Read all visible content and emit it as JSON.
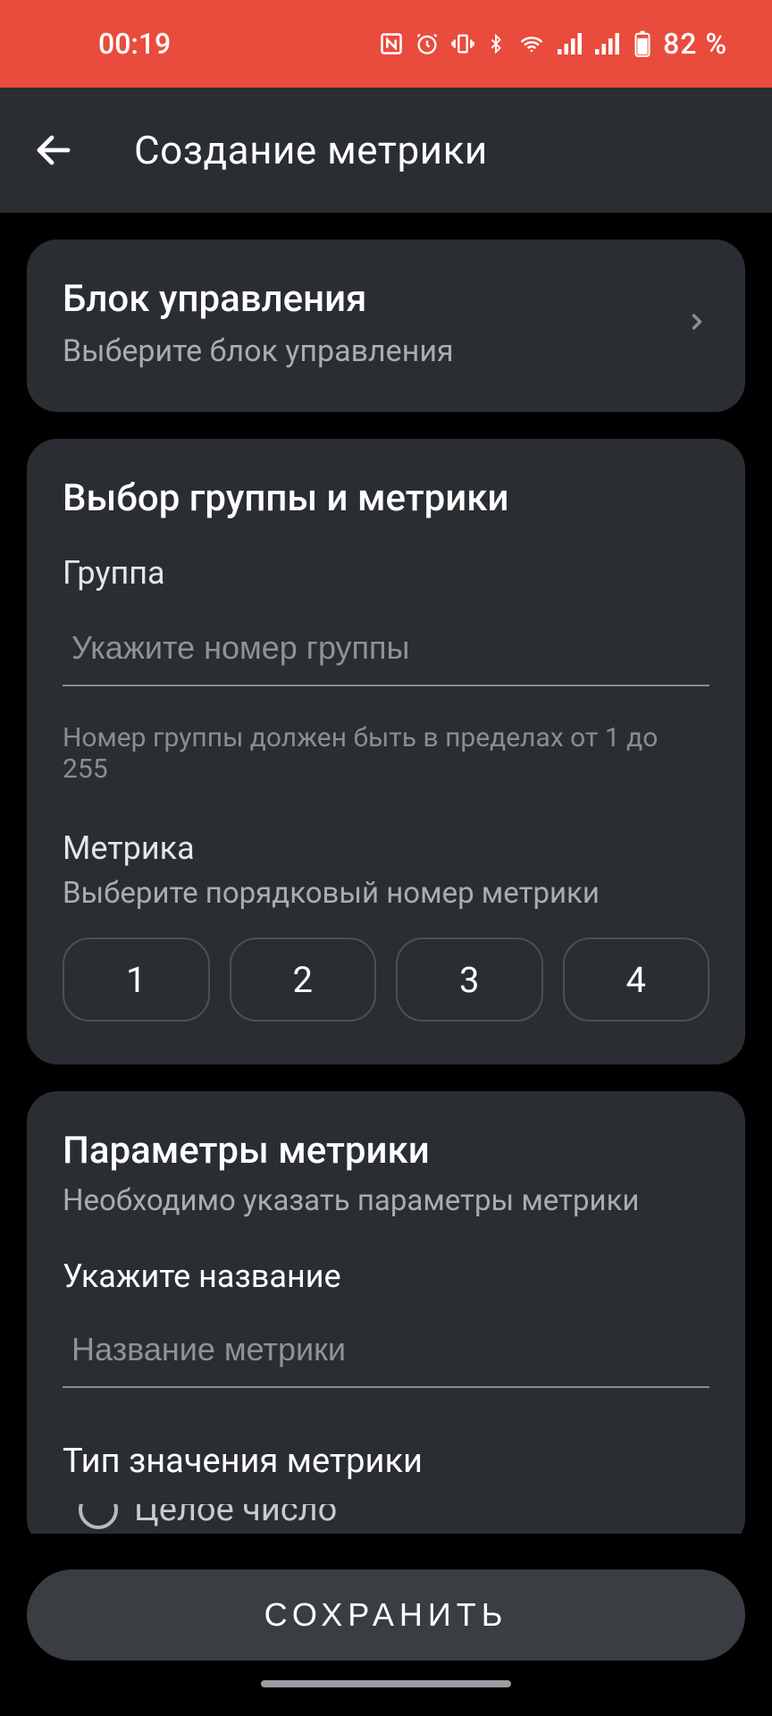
{
  "status": {
    "time": "00:19",
    "battery": "82 %"
  },
  "header": {
    "title": "Создание метрики"
  },
  "control_block": {
    "title": "Блок управления",
    "subtitle": "Выберите блок управления"
  },
  "group_section": {
    "title": "Выбор группы и метрики",
    "group_label": "Группа",
    "group_placeholder": "Укажите номер группы",
    "group_helper": "Номер группы должен быть в пределах от 1 до 255",
    "metric_label": "Метрика",
    "metric_sub": "Выберите порядковый номер метрики",
    "options": [
      "1",
      "2",
      "3",
      "4"
    ]
  },
  "params_section": {
    "title": "Параметры метрики",
    "subtitle": "Необходимо указать параметры метрики",
    "name_label": "Укажите название",
    "name_placeholder": "Название метрики",
    "type_label": "Тип значения метрики",
    "type_options": {
      "0": "Целое число"
    }
  },
  "footer": {
    "save": "СОХРАНИТЬ"
  }
}
